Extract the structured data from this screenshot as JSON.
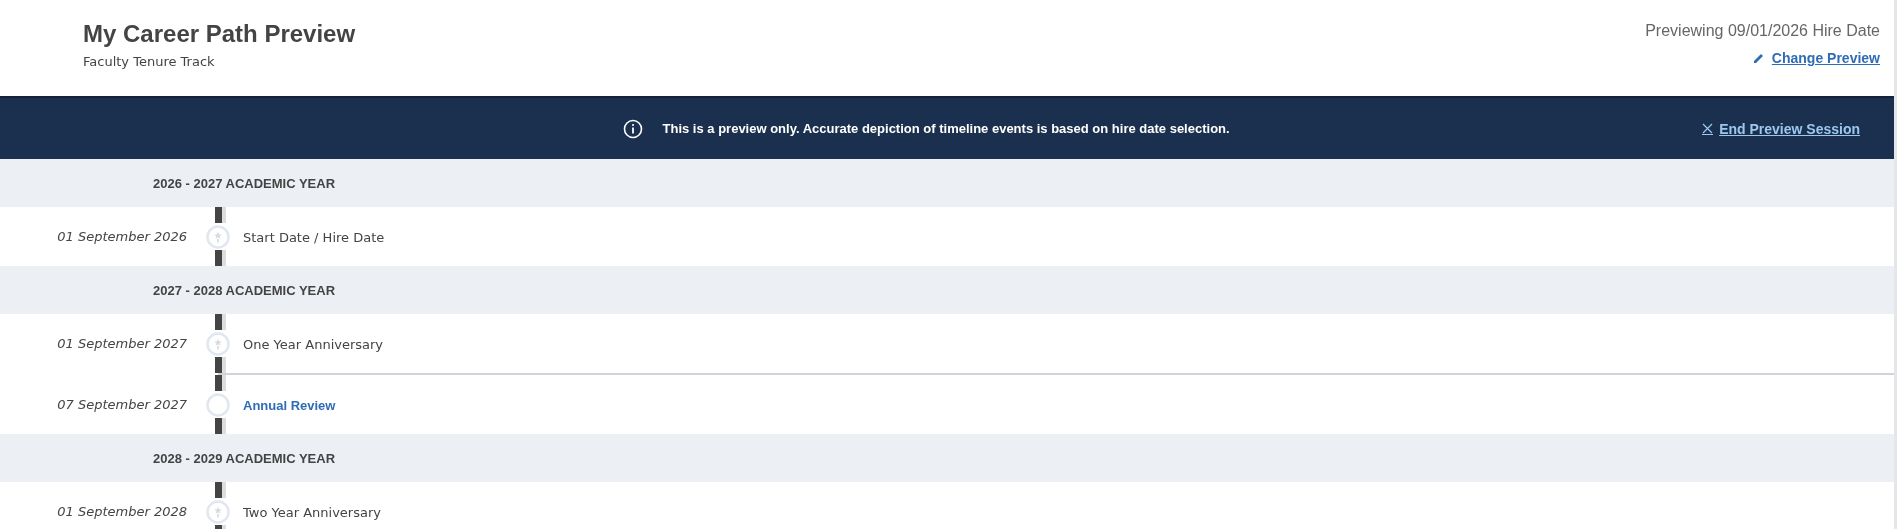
{
  "header": {
    "title": "My Career Path Preview",
    "subtitle": "Faculty Tenure Track",
    "previewing": "Previewing 09/01/2026 Hire Date",
    "change_link": "Change Preview"
  },
  "banner": {
    "message": "This is a preview only. Accurate depiction of timeline events is based on hire date selection.",
    "end_link": "End Preview Session"
  },
  "years": [
    {
      "label": "2026 - 2027 ACADEMIC YEAR",
      "events": [
        {
          "date": "01 September 2026",
          "title": "Start Date / Hire Date",
          "kind": "milestone"
        }
      ]
    },
    {
      "label": "2027 - 2028 ACADEMIC YEAR",
      "events": [
        {
          "date": "01 September 2027",
          "title": "One Year Anniversary",
          "kind": "milestone"
        },
        {
          "date": "07 September 2027",
          "title": "Annual Review",
          "kind": "review"
        }
      ]
    },
    {
      "label": "2028 - 2029 ACADEMIC YEAR",
      "events": [
        {
          "date": "01 September 2028",
          "title": "Two Year Anniversary",
          "kind": "milestone"
        }
      ]
    }
  ]
}
